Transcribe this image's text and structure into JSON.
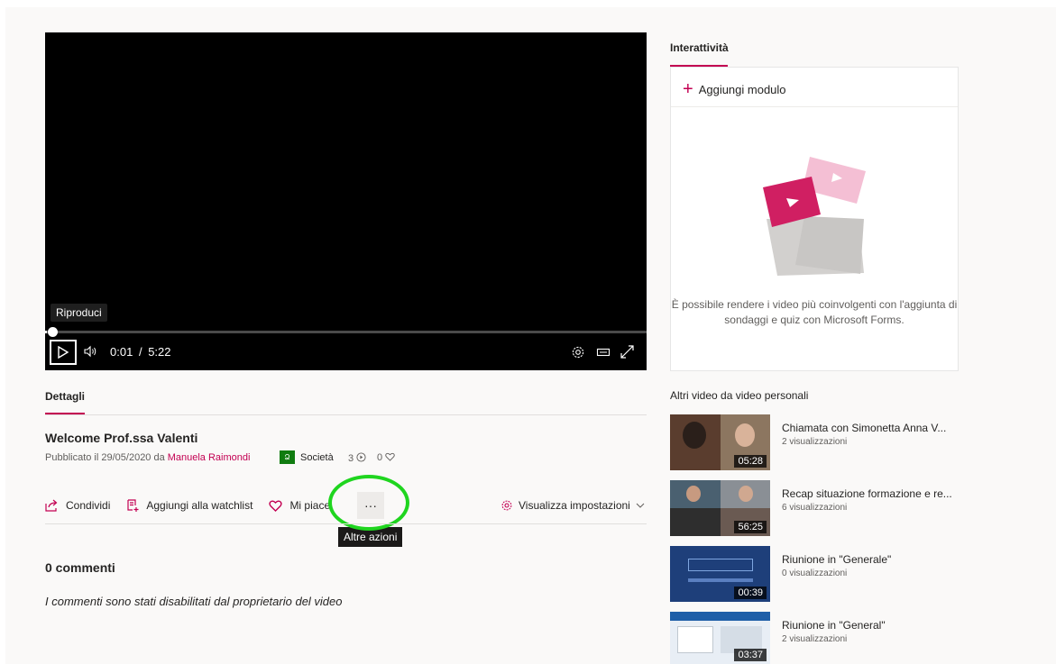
{
  "player": {
    "play_tooltip": "Riproduci",
    "current_time": "0:01",
    "time_separator": "/",
    "duration": "5:22",
    "progress_fraction": 0.003
  },
  "interactivity": {
    "tab_label": "Interattività",
    "add_module_label": "Aggiungi modulo",
    "empty_text": "È possibile rendere i video più coinvolgenti con l'aggiunta di sondaggi e quiz con Microsoft Forms."
  },
  "details": {
    "tab_label": "Dettagli",
    "video_title": "Welcome Prof.ssa Valenti",
    "published_prefix": "Pubblicato il 29/05/2020 da",
    "author": "Manuela Raimondi",
    "org_badge": "Ձ",
    "org_name": "Società",
    "views": "3",
    "likes": "0"
  },
  "actions": {
    "share_label": "Condividi",
    "watchlist_label": "Aggiungi alla watchlist",
    "like_label": "Mi piace",
    "more_label": "···",
    "more_tooltip": "Altre azioni",
    "settings_label": "Visualizza impostazioni"
  },
  "comments": {
    "title": "0 commenti",
    "note": "I commenti sono stati disabilitati dal proprietario del video"
  },
  "other_videos": {
    "title": "Altri video da video personali",
    "items": [
      {
        "title": "Chiamata con Simonetta Anna V...",
        "views": "2 visualizzazioni",
        "duration": "05:28"
      },
      {
        "title": "Recap situazione formazione e re...",
        "views": "6 visualizzazioni",
        "duration": "56:25"
      },
      {
        "title": "Riunione in \"Generale\"",
        "views": "0 visualizzazioni",
        "duration": "00:39"
      },
      {
        "title": "Riunione in \"General\"",
        "views": "2 visualizzazioni",
        "duration": "03:37"
      }
    ]
  },
  "colors": {
    "accent": "#c30052",
    "highlight": "#1fd51f"
  }
}
